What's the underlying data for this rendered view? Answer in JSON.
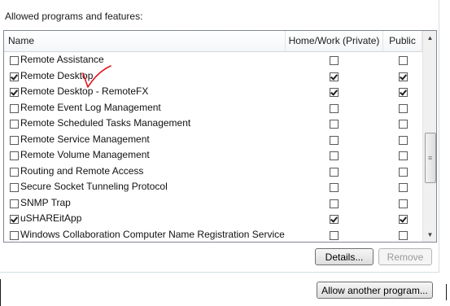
{
  "group": {
    "label": "Allowed programs and features:"
  },
  "columns": {
    "name": "Name",
    "home": "Home/Work (Private)",
    "public": "Public"
  },
  "rows": [
    {
      "name": "Remote Assistance",
      "enabled": false,
      "home": false,
      "public": false
    },
    {
      "name": "Remote Desktop",
      "enabled": true,
      "home": true,
      "public": true
    },
    {
      "name": "Remote Desktop - RemoteFX",
      "enabled": true,
      "home": true,
      "public": true
    },
    {
      "name": "Remote Event Log Management",
      "enabled": false,
      "home": false,
      "public": false
    },
    {
      "name": "Remote Scheduled Tasks Management",
      "enabled": false,
      "home": false,
      "public": false
    },
    {
      "name": "Remote Service Management",
      "enabled": false,
      "home": false,
      "public": false
    },
    {
      "name": "Remote Volume Management",
      "enabled": false,
      "home": false,
      "public": false
    },
    {
      "name": "Routing and Remote Access",
      "enabled": false,
      "home": false,
      "public": false
    },
    {
      "name": "Secure Socket Tunneling Protocol",
      "enabled": false,
      "home": false,
      "public": false
    },
    {
      "name": "SNMP Trap",
      "enabled": false,
      "home": false,
      "public": false
    },
    {
      "name": "uSHAREitApp",
      "enabled": true,
      "home": true,
      "public": true
    },
    {
      "name": "Windows Collaboration Computer Name Registration Service",
      "enabled": false,
      "home": false,
      "public": false
    }
  ],
  "buttons": {
    "details": "Details...",
    "remove": "Remove",
    "allow_another": "Allow another program..."
  },
  "icons": {
    "scroll_up": "scroll-up-arrow-icon",
    "scroll_down": "scroll-down-arrow-icon",
    "checkmark_annotation": "red-checkmark-annotation-icon"
  },
  "colors": {
    "annotation": "#e0141e",
    "list_border": "#828790",
    "disabled_text": "#9a9a9a"
  }
}
